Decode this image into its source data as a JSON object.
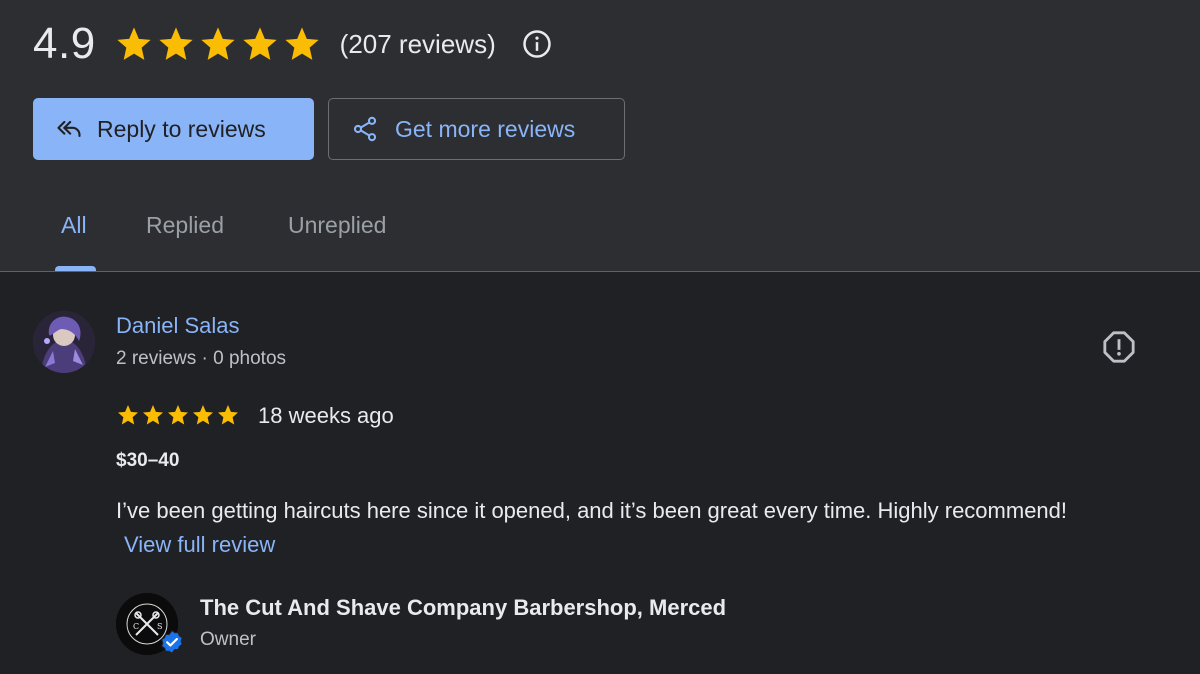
{
  "summary": {
    "rating": "4.9",
    "stars_filled": 5,
    "review_count": "(207 reviews)",
    "star_color": "#fbbc04"
  },
  "actions": {
    "reply_label": "Reply to reviews",
    "get_more_label": "Get more reviews"
  },
  "tabs": [
    {
      "label": "All",
      "active": true
    },
    {
      "label": "Replied",
      "active": false
    },
    {
      "label": "Unreplied",
      "active": false
    }
  ],
  "review": {
    "reviewer_name": "Daniel Salas",
    "reviewer_meta": "2 reviews · 0 photos",
    "stars": 5,
    "time": "18 weeks ago",
    "price": "$30–40",
    "text": "I’ve been getting haircuts here since it opened, and it’s been great every time. Highly recommend!",
    "view_full": "View full review"
  },
  "owner": {
    "name": "The Cut And Shave Company Barbershop, Merced",
    "role": "Owner"
  },
  "icons": {
    "info": "info-icon",
    "reply": "reply-all-icon",
    "share": "share-icon",
    "flag": "report-icon",
    "verified": "verified-badge-icon"
  },
  "colors": {
    "accent": "#8ab4f8",
    "header_bg": "#2d2e31",
    "body_bg": "#202124"
  }
}
